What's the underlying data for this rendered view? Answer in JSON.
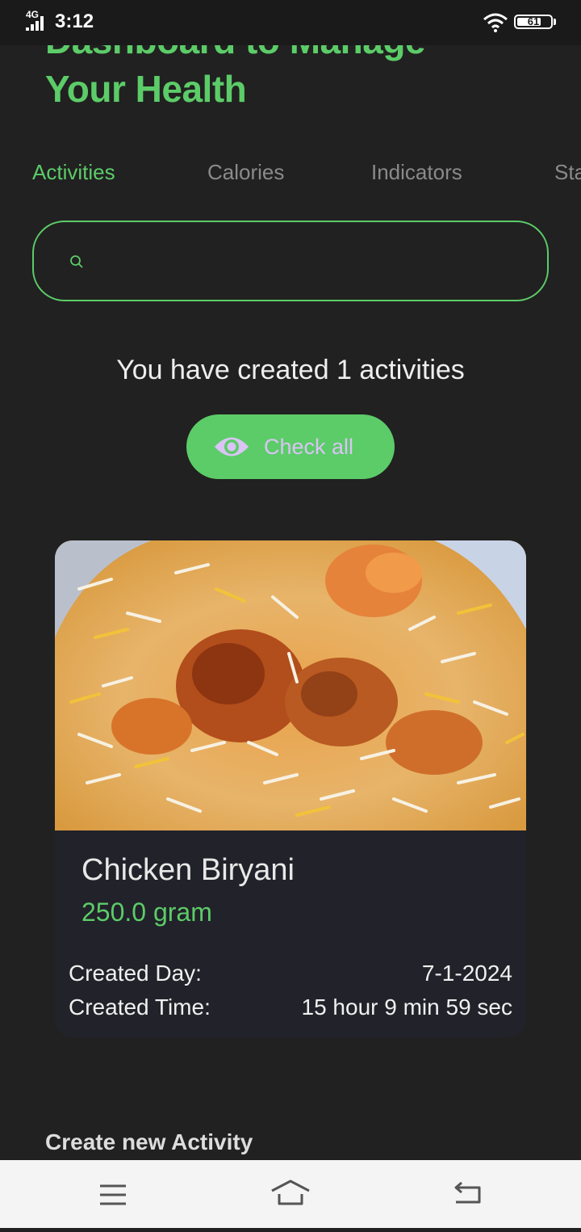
{
  "status_bar": {
    "network": "4G",
    "time": "3:12",
    "battery": "61",
    "icons": [
      "signal-icon",
      "wifi-icon",
      "battery-icon"
    ]
  },
  "header": {
    "title_line1": "Dashboard to Manage",
    "title_line2": "Your Health"
  },
  "tabs": [
    {
      "label": "Activities",
      "active": true
    },
    {
      "label": "Calories",
      "active": false
    },
    {
      "label": "Indicators",
      "active": false
    },
    {
      "label": "Sta",
      "active": false
    }
  ],
  "search": {
    "placeholder": "",
    "value": "",
    "icon": "search-icon"
  },
  "summary": {
    "text": "You have created 1 activities"
  },
  "check_all": {
    "label": "Check all",
    "icon": "eye-icon"
  },
  "activity_card": {
    "name": "Chicken Biryani",
    "quantity": "250.0 gram",
    "created_day_label": "Created Day:",
    "created_day_value": "7-1-2024",
    "created_time_label": "Created Time:",
    "created_time_value": "15 hour 9 min 59 sec"
  },
  "create_section": {
    "heading": "Create new Activity"
  },
  "nav_bar": {
    "icons": [
      "menu-icon",
      "home-icon",
      "back-icon"
    ]
  },
  "colors": {
    "accent": "#5ccc68",
    "background": "#212121",
    "card": "#22222a",
    "check_all_text": "#d9c4f5"
  }
}
